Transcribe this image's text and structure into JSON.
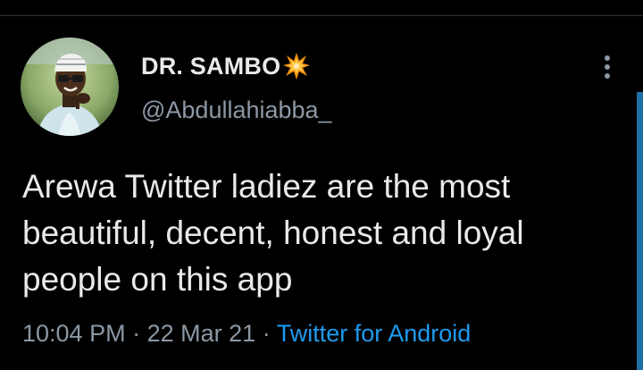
{
  "tweet": {
    "author": {
      "display_name": "DR. SAMBO",
      "name_emoji": "collision-emoji",
      "handle": "@Abdullahiabba_",
      "avatar": "profile-photo"
    },
    "text_lines": [
      "Arewa Twitter ladiez are the most",
      "beautiful, decent, honest and loyal",
      "people on this app"
    ],
    "time": "10:04 PM",
    "date": "22 Mar 21",
    "separator": "·",
    "source": "Twitter for Android"
  },
  "theme": {
    "background": "#000000",
    "primary_text": "#e7e9ea",
    "secondary_text": "#8b98a5",
    "link": "#1d9bf0",
    "scroll_indicator": "#1d6fa5"
  }
}
